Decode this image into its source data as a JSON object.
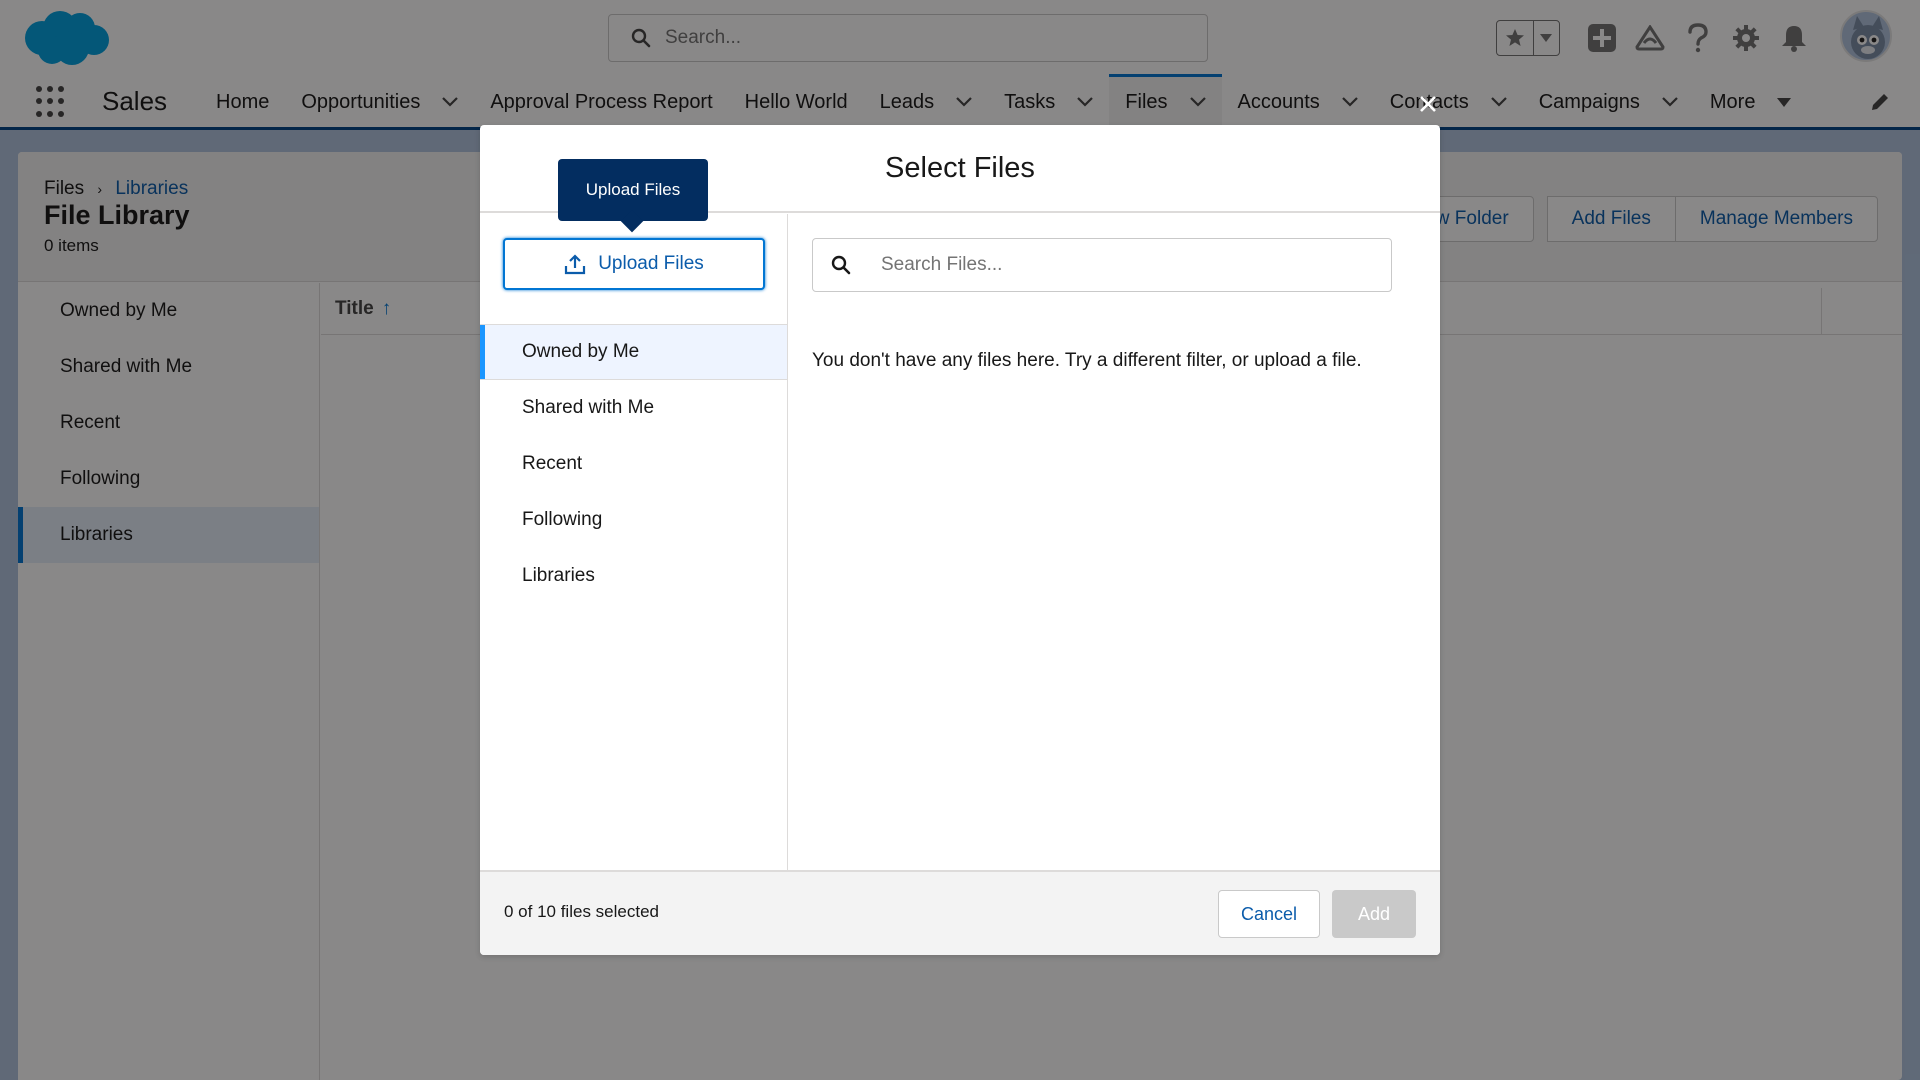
{
  "header": {
    "search_placeholder": "Search...",
    "icons": [
      "salesforce-cloud-logo",
      "search-icon",
      "star-icon",
      "chevron-down-icon",
      "add-icon",
      "trailhead-icon",
      "help-icon",
      "gear-icon",
      "bell-icon",
      "avatar"
    ]
  },
  "nav": {
    "app_name": "Sales",
    "items": [
      {
        "label": "Home",
        "dropdown": false
      },
      {
        "label": "Opportunities",
        "dropdown": true
      },
      {
        "label": "Approval Process Report",
        "dropdown": false
      },
      {
        "label": "Hello World",
        "dropdown": false
      },
      {
        "label": "Leads",
        "dropdown": true
      },
      {
        "label": "Tasks",
        "dropdown": true
      },
      {
        "label": "Files",
        "dropdown": true,
        "active": true
      },
      {
        "label": "Accounts",
        "dropdown": true
      },
      {
        "label": "Contacts",
        "dropdown": true
      },
      {
        "label": "Campaigns",
        "dropdown": true
      },
      {
        "label": "More",
        "dropdown": true
      }
    ]
  },
  "page": {
    "breadcrumb_root": "Files",
    "breadcrumb_current": "Libraries",
    "title": "File Library",
    "subtitle": "0 items",
    "actions": {
      "new_folder": "New Folder",
      "add_files": "Add Files",
      "manage_members": "Manage Members"
    },
    "filters": [
      "Owned by Me",
      "Shared with Me",
      "Recent",
      "Following",
      "Libraries"
    ],
    "selected_filter_index": 4,
    "table": {
      "column_title": "Title"
    }
  },
  "modal": {
    "title": "Select Files",
    "upload_label": "Upload Files",
    "tooltip": "Upload Files",
    "nav": [
      "Owned by Me",
      "Shared with Me",
      "Recent",
      "Following",
      "Libraries"
    ],
    "selected_nav_index": 0,
    "search_placeholder": "Search Files...",
    "empty_message": "You don't have any files here. Try a different filter, or upload a file.",
    "selection_count": "0 of 10 files selected",
    "cancel_label": "Cancel",
    "add_label": "Add"
  },
  "colors": {
    "brand": "#0176d3",
    "link": "#0b5cab",
    "tooltip_bg": "#032d60",
    "page_bg": "#b0c4df",
    "disabled_button": "#c9c9c9"
  }
}
